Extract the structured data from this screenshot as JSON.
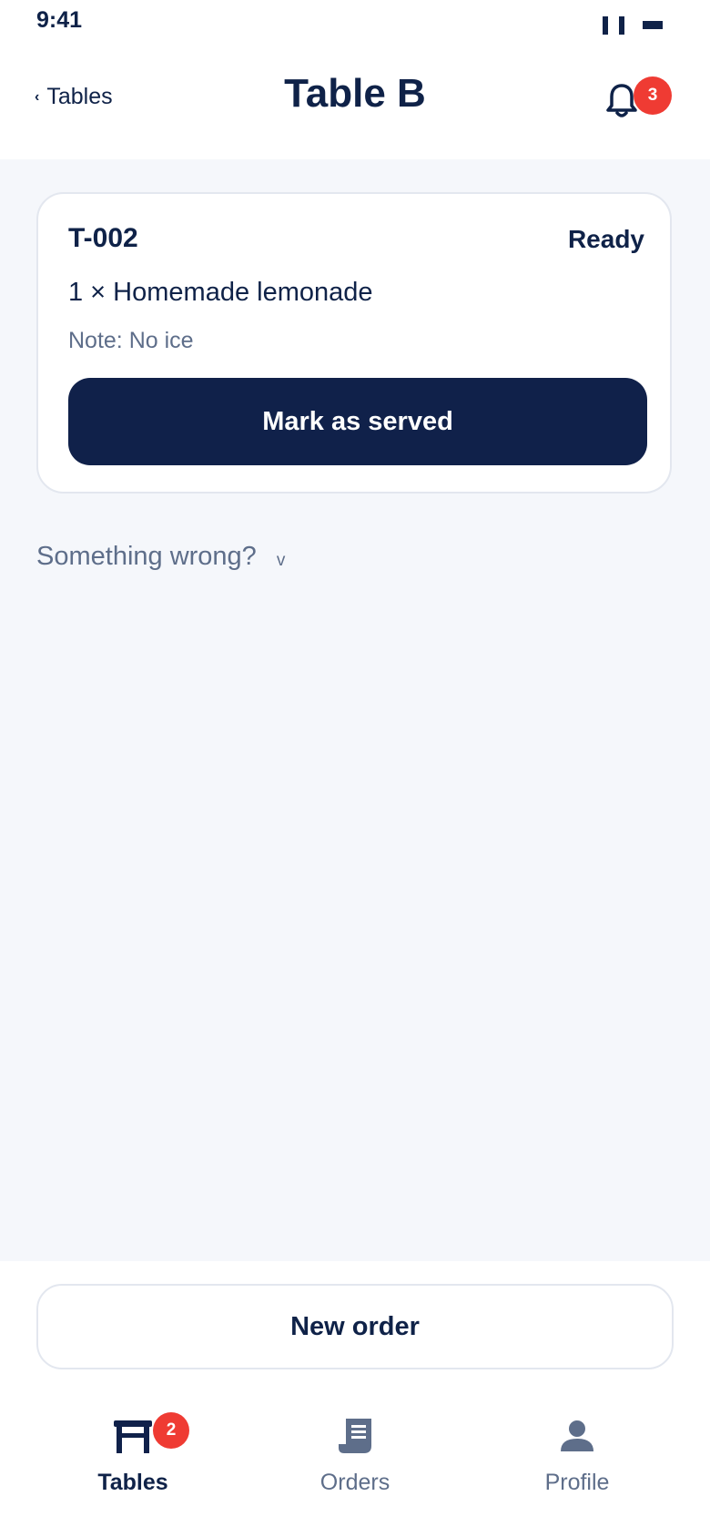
{
  "status_bar": {
    "time": "9:41"
  },
  "header": {
    "back_label": "Tables",
    "title": "Table B",
    "notification_count": "3"
  },
  "order": {
    "id": "T-002",
    "status": "Ready",
    "item": "1 × Homemade lemonade",
    "note": "Note: No ice",
    "action_label": "Mark as served"
  },
  "issue_toggle": {
    "label": "Something wrong?",
    "chevron": "v"
  },
  "new_order_label": "New order",
  "tabs": [
    {
      "label": "Tables",
      "icon": "table-icon",
      "badge": "2",
      "active": true
    },
    {
      "label": "Orders",
      "icon": "receipt-icon",
      "active": false
    },
    {
      "label": "Profile",
      "icon": "person-icon",
      "active": false
    }
  ],
  "colors": {
    "primary": "#10214a",
    "text_muted": "#5e6e8a",
    "badge": "#ef3b33",
    "background": "#f5f7fb"
  }
}
